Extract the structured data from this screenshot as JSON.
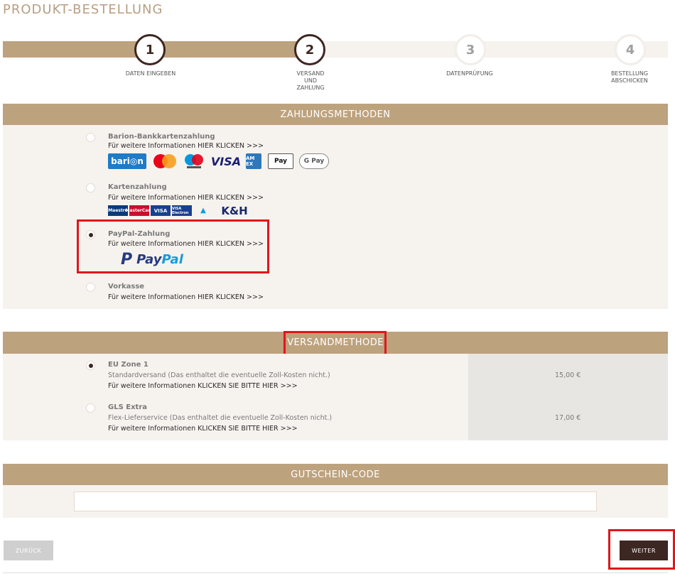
{
  "page": {
    "title": "PRODUKT-BESTELLUNG"
  },
  "steps": [
    {
      "number": "1",
      "label": "DATEN EINGEBEN",
      "state": "done"
    },
    {
      "number": "2",
      "label": "VERSAND UND ZAHLUNG",
      "state": "active"
    },
    {
      "number": "3",
      "label": "DATENPRÜFUNG",
      "state": "inactive"
    },
    {
      "number": "4",
      "label": "BESTELLUNG ABSCHICKEN",
      "state": "inactive"
    }
  ],
  "payment": {
    "heading": "ZAHLUNGSMETHODEN",
    "options": [
      {
        "title": "Barion-Bankkartenzahlung",
        "info": "Für weitere Informationen HIER KLICKEN >>>",
        "selected": false,
        "logos": [
          "barion",
          "mastercard",
          "maestro",
          "VISA",
          "AMEX",
          "Apple Pay",
          "G Pay"
        ]
      },
      {
        "title": "Kartenzahlung",
        "info": "Für weitere Informationen HIER KLICKEN >>>",
        "selected": false,
        "logos": [
          "Maestro",
          "MasterCard",
          "VISA",
          "VISA Electron",
          "K&H"
        ]
      },
      {
        "title": "PayPal-Zahlung",
        "info": "Für weitere Informationen HIER KLICKEN >>>",
        "selected": true,
        "logos": [
          "PayPal"
        ]
      },
      {
        "title": "Vorkasse",
        "info": "Für weitere Informationen HIER KLICKEN >>>",
        "selected": false
      }
    ]
  },
  "shipping": {
    "heading": "VERSANDMETHODE",
    "options": [
      {
        "title": "EU Zone 1",
        "desc": "Standardversand (Das enthaltet die eventuelle Zoll-Kosten nicht.)",
        "info": "Für weitere Informationen KLICKEN SIE BITTE HIER >>>",
        "price": "15,00 €",
        "selected": true
      },
      {
        "title": "GLS Extra",
        "desc": "Flex-Lieferservice (Das enthaltet die eventuelle Zoll-Kosten nicht.)",
        "info": "Für weitere Informationen KLICKEN SIE BITTE HIER >>>",
        "price": "17,00 €",
        "selected": false
      }
    ]
  },
  "coupon": {
    "heading": "GUTSCHEIN-CODE",
    "value": "",
    "placeholder": ""
  },
  "buttons": {
    "back": "ZURÜCK",
    "next": "WEITER"
  },
  "colors": {
    "accent": "#bda27e",
    "dark": "#3d2722",
    "panel": "#f6f2ee",
    "highlight": "#e0161b"
  }
}
